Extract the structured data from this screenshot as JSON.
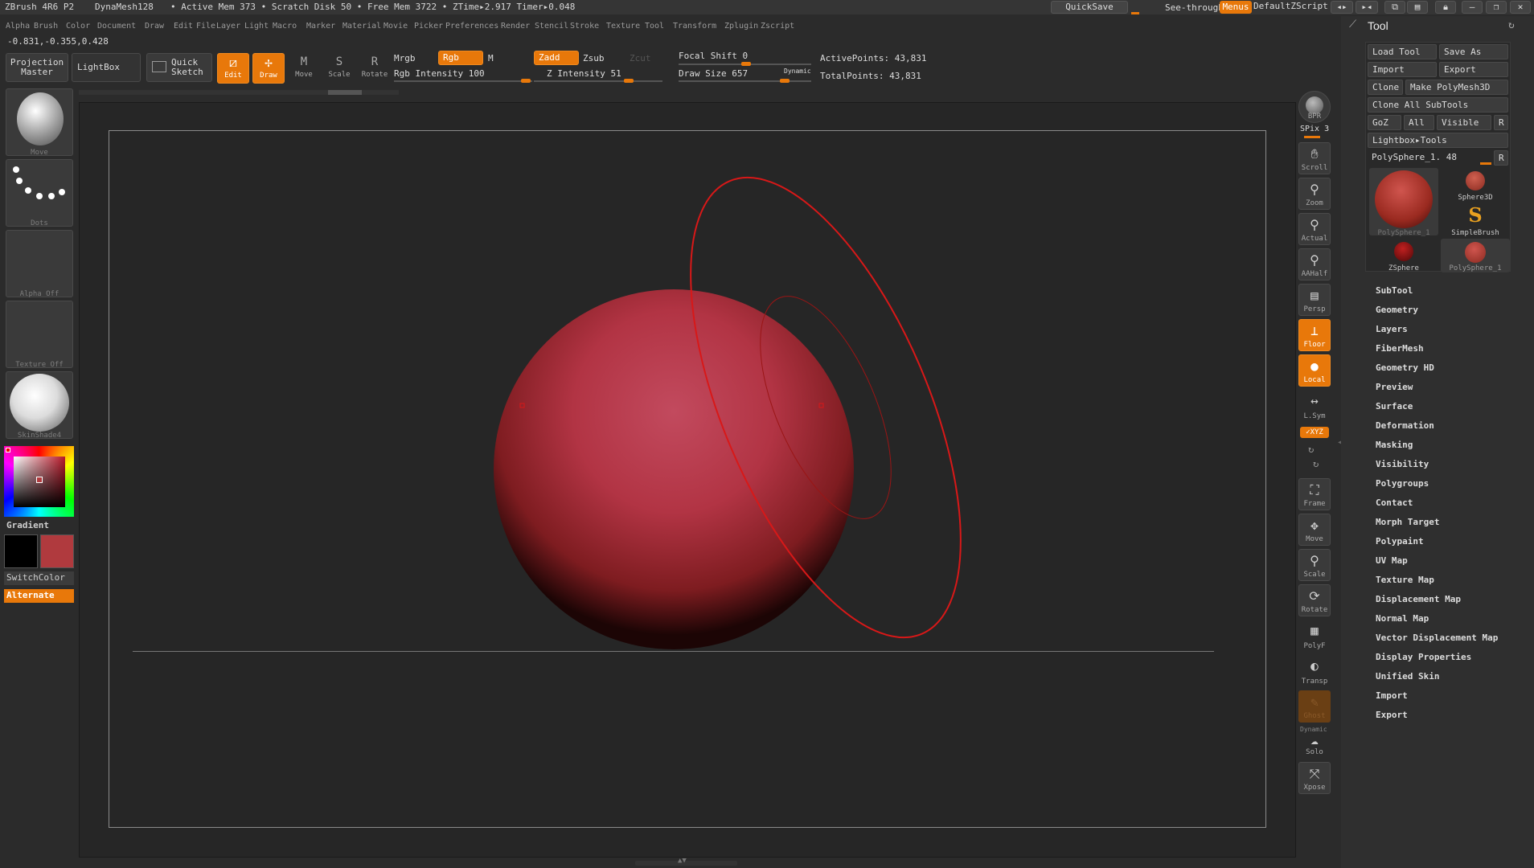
{
  "titlebar": {
    "items": [
      "ZBrush 4R6 P2",
      "DynaMesh128",
      "• Active Mem 373 • Scratch Disk 50 • Free Mem 3722 • ZTime▸2.917 Timer▸0.048"
    ],
    "quicksave": "QuickSave",
    "see_through": "See-through  0",
    "menus": "Menus",
    "script": "DefaultZScript"
  },
  "menubar": {
    "items": [
      "Alpha",
      "Brush",
      "Color",
      "Document",
      "Draw",
      "Edit",
      "File",
      "Layer",
      "Light",
      "Macro",
      "Marker",
      "Material",
      "Movie",
      "Picker",
      "Preferences",
      "Render",
      "Stencil",
      "Stroke",
      "Texture",
      "Tool",
      "Transform",
      "Zplugin",
      "Zscript"
    ]
  },
  "coords": "-0.831,-0.355,0.428",
  "shelf": {
    "projection_master_line1": "Projection",
    "projection_master_line2": "Master",
    "lightbox": "LightBox",
    "quick_sketch_line1": "Quick",
    "quick_sketch_line2": "Sketch",
    "edit": "Edit",
    "draw": "Draw",
    "move": "Move",
    "scale": "Scale",
    "rotate": "Rotate",
    "mrgb": "Mrgb",
    "rgb": "Rgb",
    "m": "M",
    "rgb_intensity": "Rgb  Intensity 100",
    "zadd": "Zadd",
    "zsub": "Zsub",
    "zcut": "Zcut",
    "z_intensity": "Z  Intensity 51",
    "focal_shift": "Focal  Shift 0",
    "draw_size": "Draw  Size 657",
    "dynamic": "Dynamic",
    "active_points": "ActivePoints: 43,831",
    "total_points": "TotalPoints: 43,831"
  },
  "left_tray": {
    "brush_caption": "Move",
    "stroke_caption": "Dots",
    "alpha_caption": "Alpha  Off",
    "texture_caption": "Texture  Off",
    "material_caption": "SkinShade4",
    "gradient": "Gradient",
    "switch_color": "SwitchColor",
    "alternate": "Alternate",
    "main_color": "#b03a3e",
    "secondary_color": "#000000"
  },
  "right_tray": {
    "bpr": "BPR",
    "spix": "SPix 3",
    "scroll": "Scroll",
    "zoom": "Zoom",
    "actual": "Actual",
    "aahalf": "AAHalf",
    "persp": "Persp",
    "floor": "Floor",
    "local": "Local",
    "lsym": "L.Sym",
    "xyz": "✓XYZ",
    "frame": "Frame",
    "move": "Move",
    "scale": "Scale",
    "rotate": "Rotate",
    "polyf": "PolyF",
    "transp": "Transp",
    "ghost": "Ghost",
    "dynamic": "Dynamic",
    "solo": "Solo",
    "xpose": "Xpose"
  },
  "tool_panel": {
    "title": "Tool",
    "load_tool": "Load  Tool",
    "save_as": "Save  As",
    "import": "Import",
    "export": "Export",
    "clone": "Clone",
    "make_polymesh": "Make  PolyMesh3D",
    "clone_all": "Clone  All  SubTools",
    "goz": "GoZ",
    "all": "All",
    "visible": "Visible",
    "r": "R",
    "lightbox_tools": "Lightbox▸Tools",
    "current_tool": "PolySphere_1. 48",
    "thumbs": [
      "PolySphere_1",
      "Sphere3D",
      "SimpleBrush",
      "ZSphere",
      "PolySphere_1"
    ],
    "menus": [
      "SubTool",
      "Geometry",
      "Layers",
      "FiberMesh",
      "Geometry  HD",
      "Preview",
      "Surface",
      "Deformation",
      "Masking",
      "Visibility",
      "Polygroups",
      "Contact",
      "Morph  Target",
      "Polypaint",
      "UV  Map",
      "Texture  Map",
      "Displacement  Map",
      "Normal  Map",
      "Vector  Displacement  Map",
      "Display  Properties",
      "Unified  Skin",
      "Import",
      "Export"
    ]
  }
}
